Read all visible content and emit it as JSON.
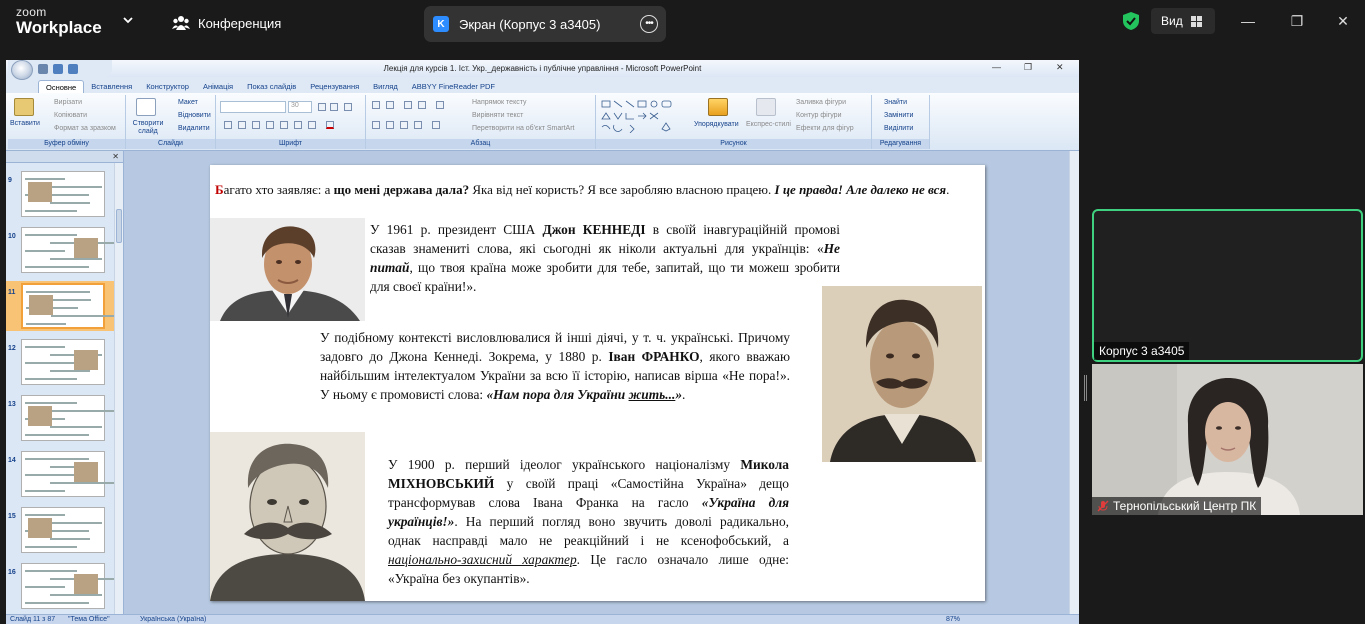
{
  "zoom": {
    "logo_line1": "zoom",
    "logo_line2": "Workplace",
    "conference_label": "Конференция",
    "share_tab_icon_letter": "K",
    "share_tab_label": "Экран (Корпус 3 а3405)",
    "view_label": "Вид",
    "accent_green": "#3fd17f"
  },
  "ppt": {
    "window_title": "Лекція для курсів 1. Іст. Укр._державність і публічне управління - Microsoft PowerPoint",
    "tabs": [
      "Основне",
      "Вставлення",
      "Конструктор",
      "Анімація",
      "Показ слайдів",
      "Рецензування",
      "Вигляд",
      "ABBYY FineReader PDF"
    ],
    "ribbon": {
      "clipboard": {
        "paste": "Вставити",
        "cut": "Вирізати",
        "copy": "Копіювати",
        "format_painter": "Формат за зразком",
        "group": "Буфер обміну"
      },
      "slides": {
        "new_slide": "Створити слайд",
        "layout": "Макет",
        "reset": "Відновити",
        "delete": "Видалити",
        "group": "Слайди"
      },
      "font": {
        "size": "30",
        "group": "Шрифт"
      },
      "paragraph": {
        "direction": "Напрямок тексту",
        "align": "Вирівняти текст",
        "smartart": "Перетворити на об'єкт SmartArt",
        "group": "Абзац"
      },
      "drawing": {
        "arrange": "Упорядкувати",
        "quick_styles": "Експрес-стилі",
        "fill": "Заливка фігури",
        "outline": "Контур фігури",
        "effects": "Ефекти для фігур",
        "group": "Рисунок"
      },
      "editing": {
        "find": "Знайти",
        "replace": "Замінити",
        "select": "Виділити",
        "group": "Редагування"
      }
    },
    "thumbnails": [
      "9",
      "10",
      "11",
      "12",
      "13",
      "14",
      "15",
      "16"
    ],
    "selected_slide": "11",
    "status": {
      "slide": "Слайд 11 з 87",
      "theme": "\"Тема Office\"",
      "lang": "Українська (Україна)",
      "zoom": "87%"
    }
  },
  "slide": {
    "p1": {
      "first_letter": "Б",
      "t1": "агато хто заявляє: а ",
      "b1": "що мені держава дала?",
      "t2": " Яка від неї користь? Я все заробляю власною працею. ",
      "bi1": "І це правда! Але далеко не вся",
      "t3": "."
    },
    "p2": {
      "t1": "У 1961 р. президент США ",
      "b1": "Джон КЕННЕДІ",
      "t2": " в своїй інавгураційній промові сказав знамениті слова, які сьогодні як ніколи актуальні для українців: «",
      "bi1": "Не питай",
      "t3": ", що твоя країна може зробити для тебе, запитай, що ти можеш зробити для своєї країни!»."
    },
    "p3": {
      "t1": "У подібному контексті висловлювалися й інші діячі, у т. ч. українські. Причому задовго до Джона Кеннеді. Зокрема, у 1880 р. ",
      "b1": "Іван ФРАНКО",
      "t2": ", якого вважаю найбільшим інтелектуалом України за всю її історію, написав вірша «Не пора!». У ньому є промовисті слова: ",
      "bi1": "«Нам пора для України ",
      "bi_ul": "жить...",
      "bi2": "»",
      "t3": "."
    },
    "p4": {
      "t1": "У 1900 р. перший ідеолог українського націоналізму ",
      "b1": "Микола МІХНОВСЬКИЙ",
      "t2": " у своїй праці «Самостійна Україна» дещо трансформував слова Івана Франка на гасло ",
      "bi1": "«Україна для українців!»",
      "t3": ". На перший погляд воно звучить доволі радикально, однак насправді мало не реакційний і не ксенофобський, а ",
      "iu": "національно-захисний характер",
      "t4": ". Це гасло означало лише одне: «Україна без окупантів»."
    }
  },
  "participants": [
    {
      "name": "Корпус 3 а3405"
    },
    {
      "name": "Тернопільський Центр ПК"
    }
  ]
}
